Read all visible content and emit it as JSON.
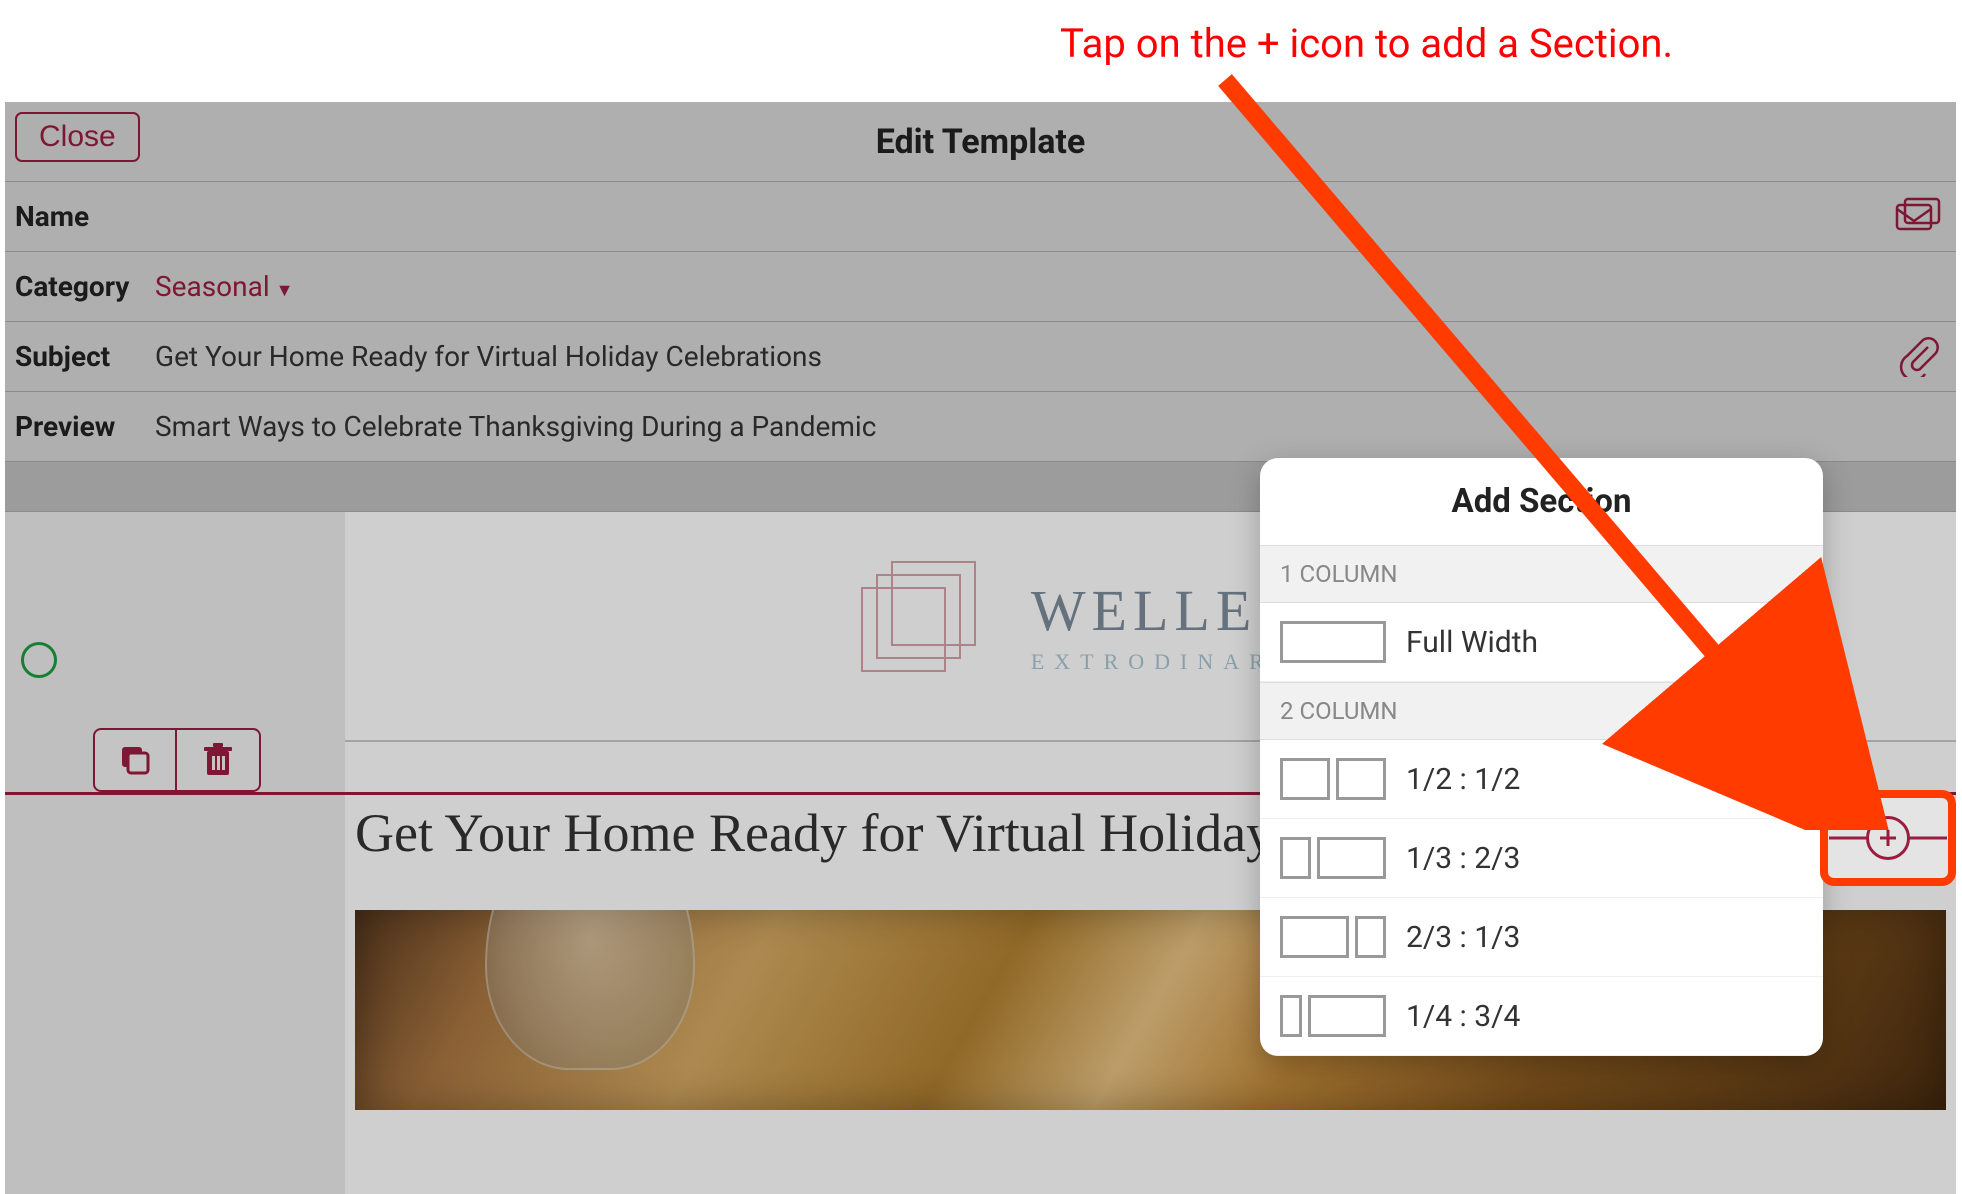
{
  "annotation": "Tap on the + icon to add a Section.",
  "topbar": {
    "close_label": "Close",
    "title": "Edit Template"
  },
  "form": {
    "name_label": "Name",
    "name_value": "",
    "category_label": "Category",
    "category_value": "Seasonal",
    "subject_label": "Subject",
    "subject_value": "Get Your Home Ready for Virtual Holiday Celebrations",
    "preview_label": "Preview",
    "preview_value": "Smart Ways to Celebrate Thanksgiving During a Pandemic"
  },
  "logo": {
    "main": "WELLESLEY",
    "sub": "EXTRODINARY HOMES"
  },
  "content": {
    "headline": "Get Your Home Ready for Virtual Holiday Celebrations"
  },
  "popover": {
    "title": "Add Section",
    "groups": [
      {
        "header": "1 COLUMN",
        "items": [
          {
            "label": "Full Width",
            "cols": [
              100
            ]
          }
        ]
      },
      {
        "header": "2 COLUMN",
        "items": [
          {
            "label": "1/2 : 1/2",
            "cols": [
              50,
              50
            ]
          },
          {
            "label": "1/3 : 2/3",
            "cols": [
              33,
              67
            ]
          },
          {
            "label": "2/3 : 1/3",
            "cols": [
              67,
              33
            ]
          },
          {
            "label": "1/4 : 3/4",
            "cols": [
              25,
              75
            ]
          }
        ]
      }
    ]
  },
  "colors": {
    "accent": "#9a1d3f",
    "annotation_red": "#ff0000"
  }
}
